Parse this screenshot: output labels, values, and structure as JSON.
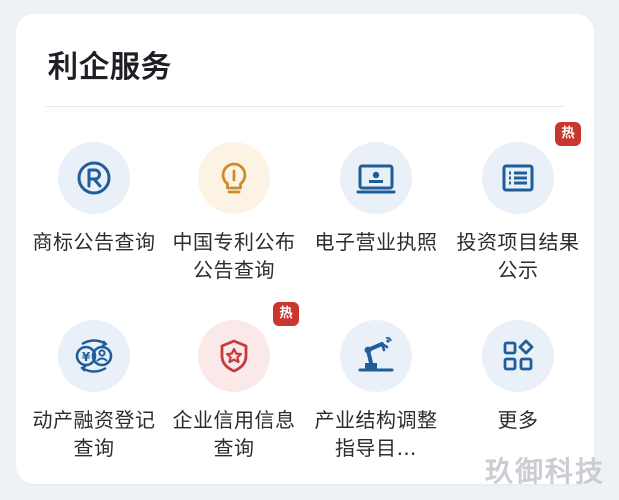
{
  "card": {
    "title": "利企服务"
  },
  "items": [
    {
      "label": "商标公告查询",
      "icon": "trademark-r-icon",
      "bg": "#e9f0f8",
      "color": "#1f5e9a",
      "hot": false
    },
    {
      "label": "中国专利公布公告查询",
      "icon": "lightbulb-icon",
      "bg": "#fdf3e4",
      "color": "#c98e2b",
      "hot": false
    },
    {
      "label": "电子营业执照",
      "icon": "license-card-icon",
      "bg": "#e9f0f8",
      "color": "#1f5e9a",
      "hot": false
    },
    {
      "label": "投资项目结果公示",
      "icon": "document-list-icon",
      "bg": "#e9f0f8",
      "color": "#1f5e9a",
      "hot": true,
      "badge": "热"
    },
    {
      "label": "动产融资登记查询",
      "icon": "finance-exchange-icon",
      "bg": "#e9f0f8",
      "color": "#1f5e9a",
      "hot": false
    },
    {
      "label": "企业信用信息查询",
      "icon": "shield-star-icon",
      "bg": "#fbe9ea",
      "color": "#c63b3b",
      "hot": true,
      "badge": "热"
    },
    {
      "label": "产业结构调整指导目…",
      "icon": "robot-arm-icon",
      "bg": "#e9f0f8",
      "color": "#1f5e9a",
      "hot": false
    },
    {
      "label": "更多",
      "icon": "more-grid-icon",
      "bg": "#e9f0f8",
      "color": "#1f5e9a",
      "hot": false
    }
  ],
  "watermark": "玖御科技"
}
